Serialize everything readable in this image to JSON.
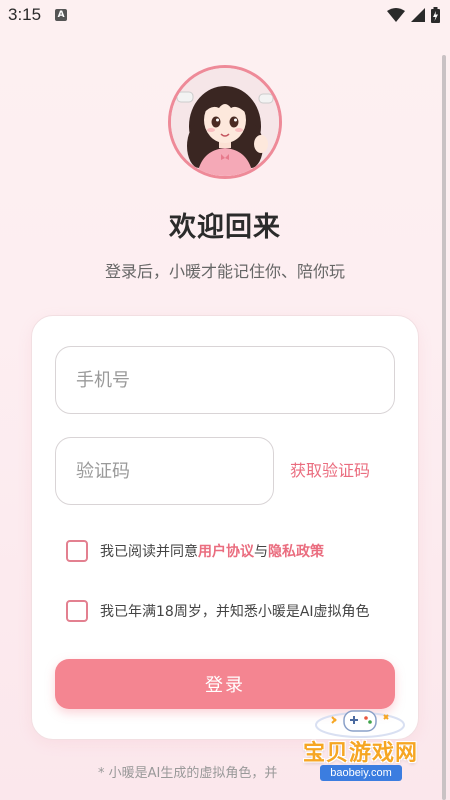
{
  "status_bar": {
    "time": "3:15",
    "notification_icon": "a-badge-icon",
    "wifi_icon": "wifi-icon",
    "signal_icon": "signal-icon",
    "battery_icon": "battery-charging-icon"
  },
  "header": {
    "avatar": "anime-girl-avatar",
    "title": "欢迎回来",
    "subtitle": "登录后，小暖才能记住你、陪你玩"
  },
  "form": {
    "phone_placeholder": "手机号",
    "code_placeholder": "验证码",
    "get_code_label": "获取验证码",
    "agreement": {
      "prefix": "我已阅读并同意",
      "user_agreement": "用户协议",
      "connector": "与",
      "privacy_policy": "隐私政策"
    },
    "age_confirm": "我已年满18周岁，并知悉小暖是AI虚拟角色",
    "login_label": "登录"
  },
  "footer": {
    "note": "* 小暖是AI生成的虚拟角色，并"
  },
  "watermark": {
    "title": "宝贝游戏网",
    "url": "baobeiy.com"
  },
  "colors": {
    "accent": "#f48591",
    "link": "#ea6d7f",
    "background": "#fdf0f1"
  }
}
